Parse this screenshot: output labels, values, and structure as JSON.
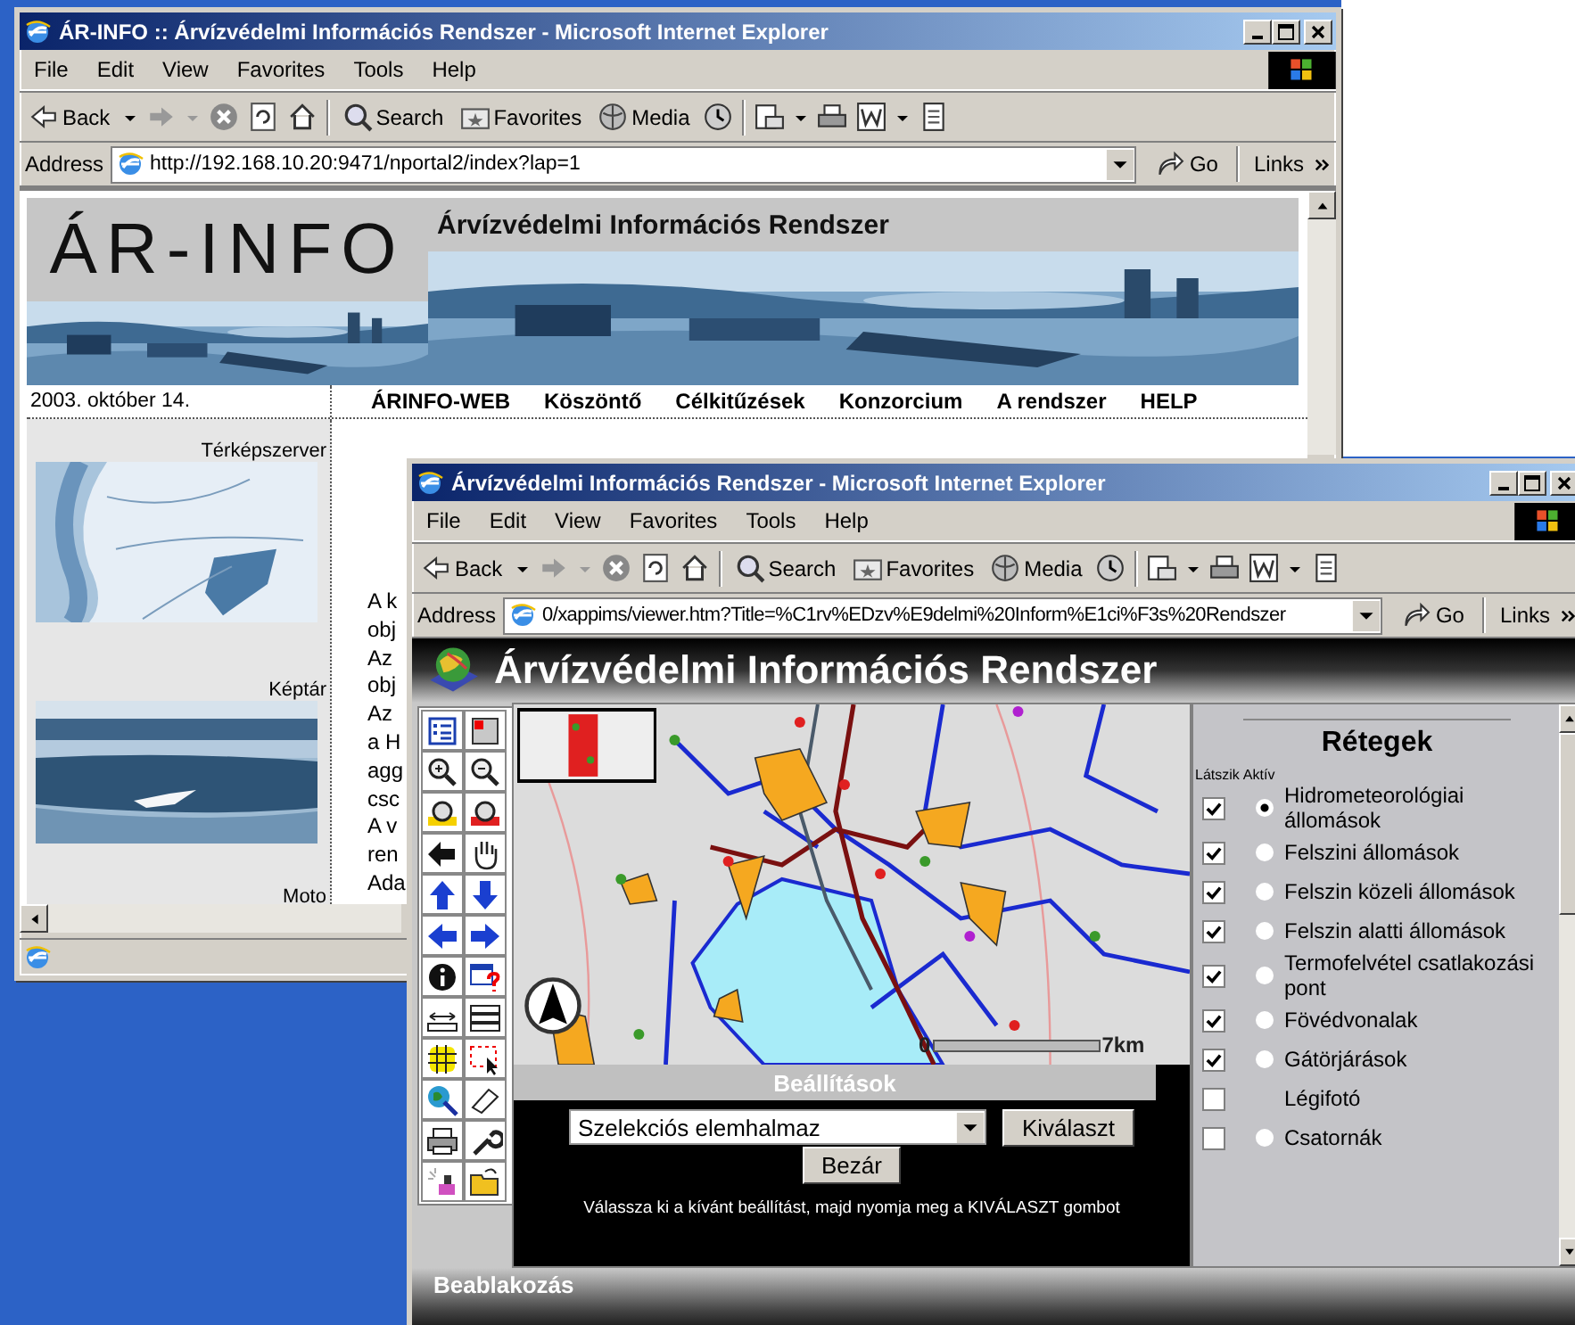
{
  "windows": [
    {
      "title": "ÁR-INFO :: Árvízvédelmi Információs Rendszer - Microsoft Internet Explorer",
      "menu": [
        "File",
        "Edit",
        "View",
        "Favorites",
        "Tools",
        "Help"
      ],
      "toolbar": {
        "back": "Back",
        "search": "Search",
        "favorites": "Favorites",
        "media": "Media"
      },
      "address": {
        "label": "Address",
        "url": "http://192.168.10.20:9471/nportal2/index?lap=1"
      },
      "go": "Go",
      "links": "Links",
      "page": {
        "kind": "portal",
        "logo": "ÁR-INFO",
        "subtitle": "Árvízvédelmi Információs Rendszer",
        "date": "2003. október 14.",
        "nav": [
          "ÁRINFO-WEB",
          "Köszöntő",
          "Célkitűzések",
          "Konzorcium",
          "A rendszer",
          "HELP"
        ],
        "sidebar": [
          {
            "label": "Térképszerver",
            "kind": "map"
          },
          {
            "label": "Képtár",
            "kind": "picture"
          },
          {
            "label": "Moto",
            "kind": "text"
          }
        ],
        "text_fragments": [
          "A k",
          "obj",
          "Az",
          "obj",
          "Az",
          "a H",
          "agg",
          "csc",
          "A v",
          "ren",
          "Ada"
        ]
      }
    },
    {
      "title": "Árvízvédelmi Információs Rendszer - Microsoft Internet Explorer",
      "menu": [
        "File",
        "Edit",
        "View",
        "Favorites",
        "Tools",
        "Help"
      ],
      "toolbar": {
        "back": "Back",
        "search": "Search",
        "favorites": "Favorites",
        "media": "Media"
      },
      "address": {
        "label": "Address",
        "url": "0/xappims/viewer.htm?Title=%C1rv%EDzv%E9delmi%20Inform%E1ci%F3s%20Rendszer"
      },
      "go": "Go",
      "links": "Links",
      "page": {
        "kind": "viewer",
        "app_title": "Árvízvédelmi Információs Rendszer",
        "scale": {
          "start": "0",
          "end": "7km"
        },
        "settings": {
          "title": "Beállítások",
          "select": "Szelekciós elemhalmaz",
          "select_button": "Kiválaszt",
          "close_button": "Bezár",
          "hint": "Válassza ki a kívánt beállítást, majd nyomja meg a KIVÁLASZT gombot"
        },
        "layers": {
          "title": "Rétegek",
          "visible_header": "Látszik",
          "active_header": "Aktív",
          "items": [
            {
              "label": "Hidrometeorológiai állomások",
              "visible": true,
              "kind": "radio",
              "selected": true
            },
            {
              "label": "Felszini állomások",
              "visible": true,
              "kind": "radio",
              "selected": false
            },
            {
              "label": "Felszin közeli állomások",
              "visible": true,
              "kind": "radio",
              "selected": false
            },
            {
              "label": "Felszin alatti állomások",
              "visible": true,
              "kind": "radio",
              "selected": false
            },
            {
              "label": "Termofelvétel csatlakozási pont",
              "visible": true,
              "kind": "radio",
              "selected": false
            },
            {
              "label": "Fövédvonalak",
              "visible": true,
              "kind": "radio",
              "selected": false
            },
            {
              "label": "Gátörjárások",
              "visible": true,
              "kind": "radio",
              "selected": false
            },
            {
              "label": "Légifotó",
              "visible": false,
              "kind": "plain"
            },
            {
              "label": "Csatornák",
              "visible": false,
              "kind": "radio",
              "selected": false
            }
          ]
        },
        "footer": "Beablakozás"
      }
    }
  ]
}
